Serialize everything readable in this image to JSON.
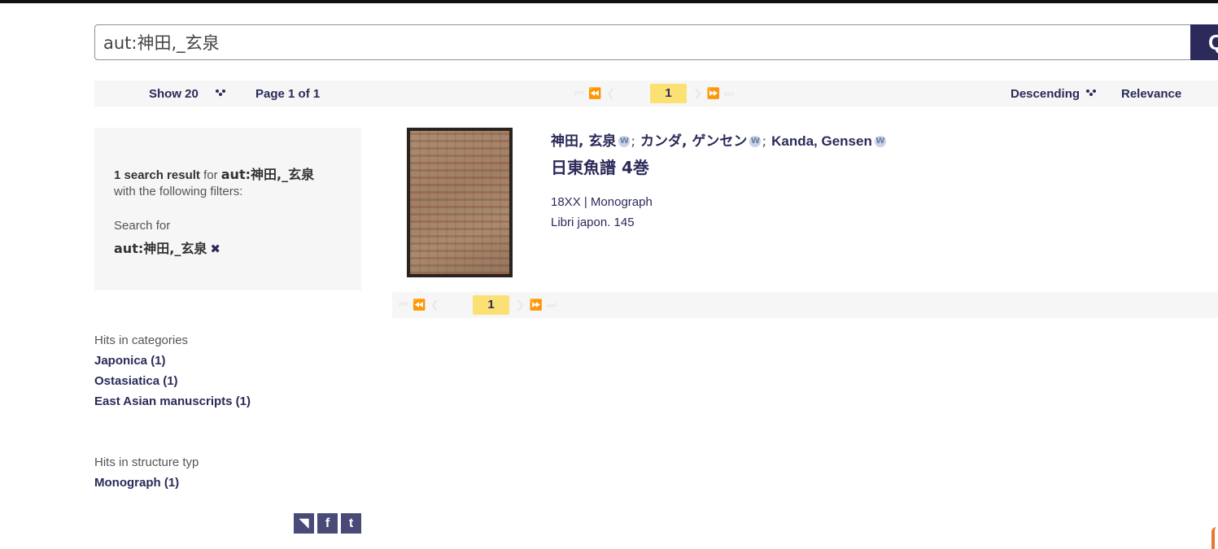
{
  "search": {
    "value": "aut:神田,_玄泉",
    "button_label": "Q"
  },
  "toolbar": {
    "show_label": "Show 20",
    "page_label": "Page 1 of 1",
    "sort_order": "Descending",
    "sort_field": "Relevance",
    "current_page": "1",
    "ghost_left": "⏮  ⏪  ❮",
    "ghost_right": "❯  ⏩  ⏭"
  },
  "filters": {
    "count_strong": "1 search result",
    "for_text": " for ",
    "query_strong": "aut:神田,_玄泉",
    "with_filters": "with the following filters:",
    "search_for_label": "Search for",
    "active_filter": "aut:神田,_玄泉",
    "remove_icon": "✖"
  },
  "facets": {
    "categories_heading": "Hits in categories",
    "categories": [
      "Japonica (1)",
      "Ostasiatica (1)",
      "East Asian manuscripts (1)"
    ],
    "structure_heading": "Hits in structure typ",
    "structure": [
      "Monograph (1)"
    ]
  },
  "social": {
    "rss": "◥",
    "facebook": "f",
    "twitter": "t"
  },
  "result": {
    "author_1": "神田, 玄泉",
    "author_2": "カンダ, ゲンセン",
    "author_3": "Kanda, Gensen",
    "separator": ";",
    "wiki_icon": "W",
    "title": "日東魚譜 4巻",
    "date_type": "18XX | Monograph",
    "shelfmark": "Libri japon. 145"
  },
  "bottom_pager": {
    "current_page": "1",
    "ghost_left": "⏮  ⏪  ❮",
    "ghost_right": "❯  ⏩  ⏭"
  },
  "colors": {
    "brand": "#2b2a5a",
    "highlight": "#fbe174",
    "panel": "#f6f6f6"
  }
}
